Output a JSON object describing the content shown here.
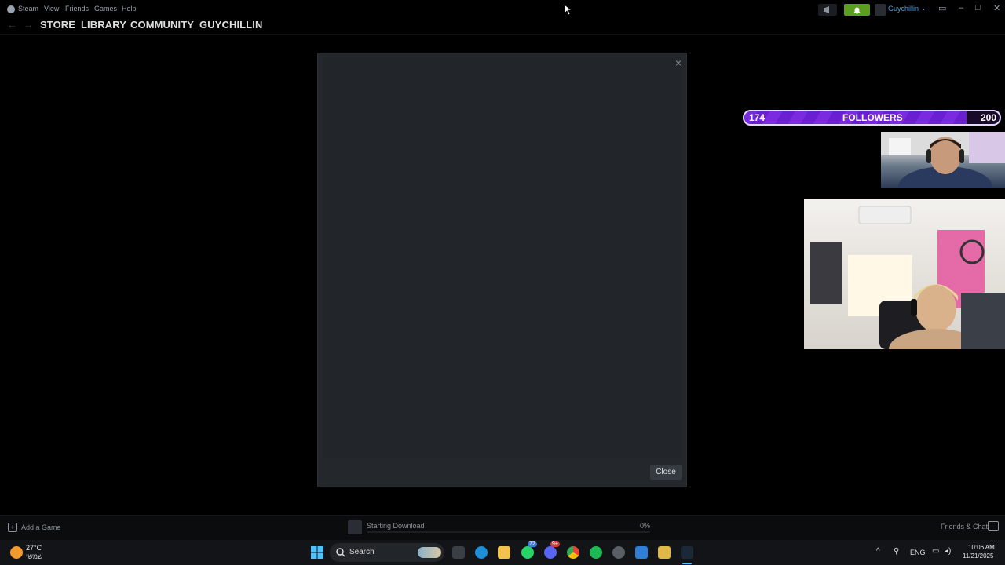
{
  "menubar": {
    "items": [
      "Steam",
      "View",
      "Friends",
      "Games",
      "Help"
    ],
    "username": "Guychillin"
  },
  "nav": {
    "links": [
      "STORE",
      "LIBRARY",
      "COMMUNITY",
      "GUYCHILLIN"
    ]
  },
  "modal": {
    "close_label": "Close",
    "close_x": "×"
  },
  "followers": {
    "current": "174",
    "label": "FOLLOWERS",
    "goal": "200",
    "progress": 0.87
  },
  "bottombar": {
    "add_game": "Add a Game",
    "download_status": "Starting Download",
    "download_percent": "0%",
    "friends_chat": "Friends & Chat"
  },
  "taskbar": {
    "weather_temp": "27°C",
    "weather_desc": "שמשי",
    "search_placeholder": "Search",
    "lang": "ENG",
    "time": "10:06 AM",
    "date": "11/21/2025",
    "badge_whatsapp": "72",
    "badge_discord": "9+"
  },
  "colors": {
    "accent_green": "#5c9e1f",
    "followers_purple": "#7a2be0",
    "username_blue": "#4c9be8"
  }
}
